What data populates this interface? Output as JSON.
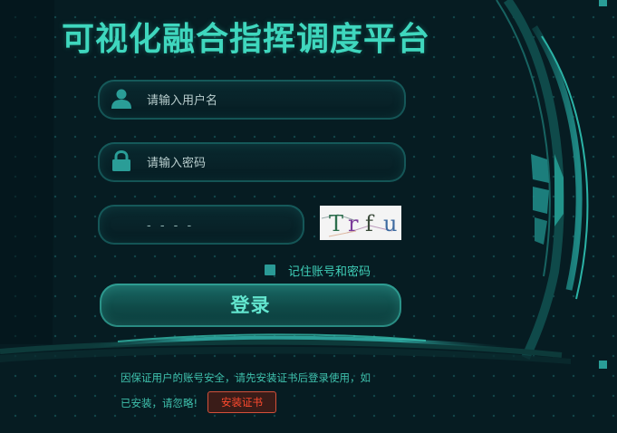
{
  "title": "可视化融合指挥调度平台",
  "form": {
    "username_placeholder": "请输入用户名",
    "password_placeholder": "请输入密码",
    "captcha_placeholder": "- - - -",
    "captcha_chars": [
      "T",
      "r",
      "f",
      "u"
    ],
    "remember_label": "记住账号和密码",
    "login_label": "登录"
  },
  "notice": {
    "line1": "因保证用户的账号安全，请先安装证书后登录使用，如",
    "line2": "已安装，请忽略!",
    "install_cert_label": "安装证书"
  },
  "icons": {
    "username": "user-icon",
    "password": "lock-icon"
  },
  "colors": {
    "accent": "#3fd7be",
    "background": "#061c22",
    "warning": "#ff4a2e"
  }
}
